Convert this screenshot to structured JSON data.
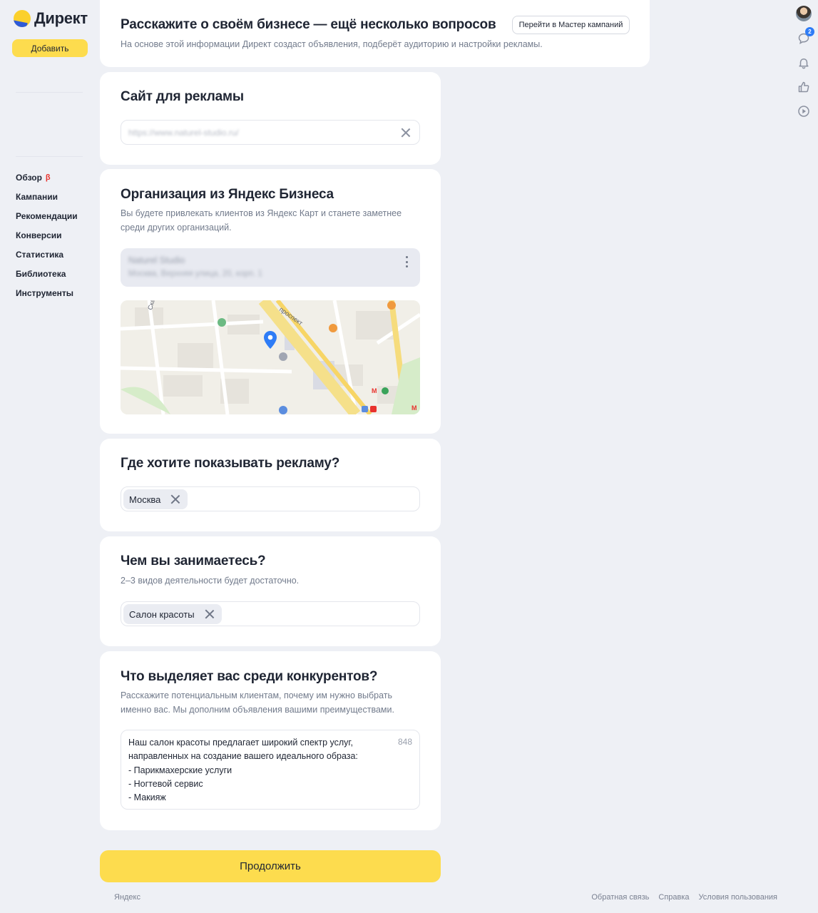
{
  "sidebar": {
    "logo_text": "Директ",
    "add_button": "Добавить",
    "nav": [
      {
        "label": "Обзор",
        "badge": "β"
      },
      {
        "label": "Кампании"
      },
      {
        "label": "Рекомендации"
      },
      {
        "label": "Конверсии"
      },
      {
        "label": "Статистика"
      },
      {
        "label": "Библиотека"
      },
      {
        "label": "Инструменты"
      }
    ]
  },
  "rail": {
    "messages_badge": "2"
  },
  "header": {
    "title": "Расскажите о своём бизнесе — ещё несколько вопросов",
    "subtitle": "На основе этой информации Директ создаст объявления, подберёт аудиторию и настройки рекламы.",
    "wizard_button": "Перейти в Мастер кампаний"
  },
  "site": {
    "title": "Сайт для рекламы",
    "url_value": "https://www.naturel-studio.ru/"
  },
  "organization": {
    "title": "Организация из Яндекс Бизнеса",
    "subtitle_line1": "Вы будете привлекать клиентов из Яндекс Карт и станете заметнее",
    "subtitle_line2": "среди других организаций.",
    "org_name": "Naturel Studio",
    "org_address": "Москва, Верхняя улица, 20, корп. 1",
    "map_labels": [
      "проспект",
      "Ска"
    ]
  },
  "geo": {
    "title": "Где хотите показывать рекламу?",
    "chips": [
      "Москва"
    ]
  },
  "activity": {
    "title": "Чем вы занимаетесь?",
    "subtitle": "2–3 видов деятельности будет достаточно.",
    "chips": [
      "Салон красоты"
    ]
  },
  "advantages": {
    "title": "Что выделяет вас среди конкурентов?",
    "subtitle_line1": "Расскажите потенциальным клиентам, почему им нужно выбрать",
    "subtitle_line2": "именно вас. Мы дополним объявления вашими преимуществами.",
    "text": "Наш салон красоты предлагает широкий спектр услуг,\nнаправленных на создание вашего идеального образа:\n- Парикмахерские услуги\n- Ногтевой сервис\n- Макияж",
    "counter": "848"
  },
  "continue_button": "Продолжить",
  "footer": {
    "brand": "Яндекс",
    "links": [
      "Обратная связь",
      "Справка",
      "Условия пользования"
    ]
  },
  "colors": {
    "accent_yellow": "#fddc4e",
    "background": "#eef0f5",
    "badge_blue": "#2e7cf6",
    "beta_red": "#e8322d"
  }
}
